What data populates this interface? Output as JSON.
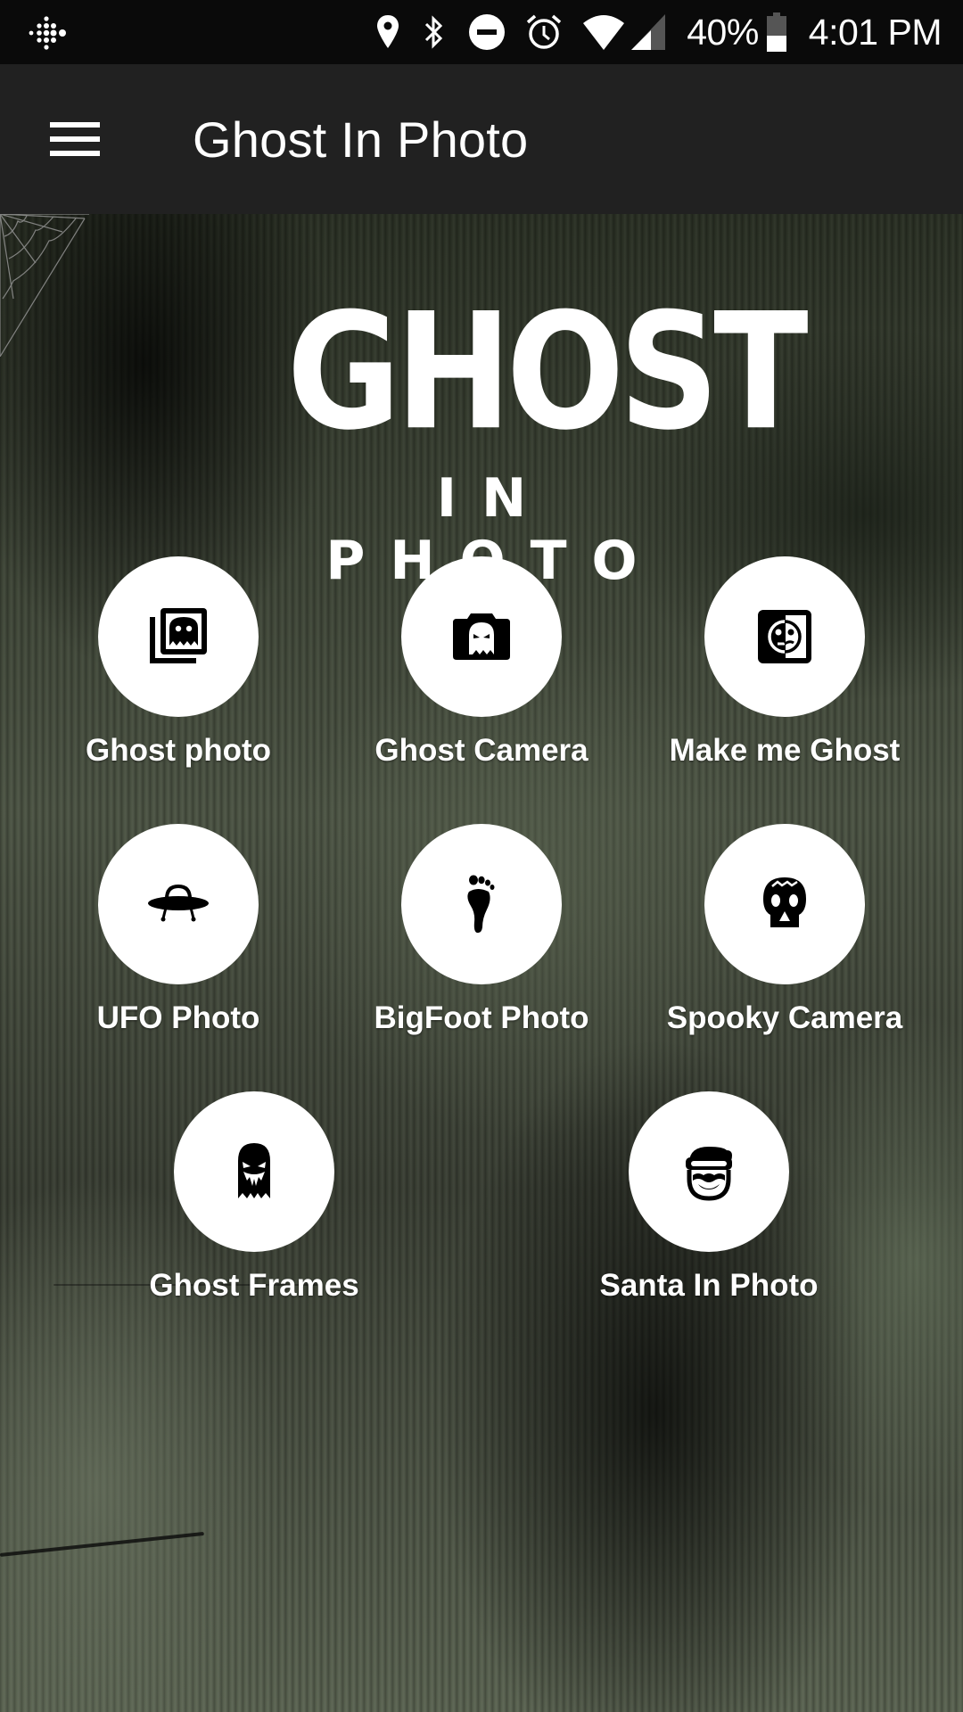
{
  "status_bar": {
    "left_icon": "fitbit-icon",
    "icons": [
      "location-icon",
      "bluetooth-icon",
      "do-not-disturb-icon",
      "alarm-icon",
      "wifi-icon",
      "cell-signal-icon"
    ],
    "battery_percent": "40%",
    "battery_icon": "battery-icon",
    "time": "4:01 PM"
  },
  "app_bar": {
    "menu_icon": "hamburger-menu-icon",
    "title": "Ghost In Photo"
  },
  "logo": {
    "main": "GHOST",
    "sub": "IN PHOTO"
  },
  "features": [
    {
      "label": "Ghost photo",
      "icon": "ghost-gallery-icon"
    },
    {
      "label": "Ghost Camera",
      "icon": "ghost-camera-icon"
    },
    {
      "label": "Make me Ghost",
      "icon": "half-face-icon"
    },
    {
      "label": "UFO Photo",
      "icon": "ufo-icon"
    },
    {
      "label": "BigFoot Photo",
      "icon": "footprint-icon"
    },
    {
      "label": "Spooky Camera",
      "icon": "sugar-skull-icon"
    },
    {
      "label": "Ghost Frames",
      "icon": "scary-ghost-icon"
    },
    {
      "label": "Santa In Photo",
      "icon": "santa-face-icon"
    }
  ]
}
